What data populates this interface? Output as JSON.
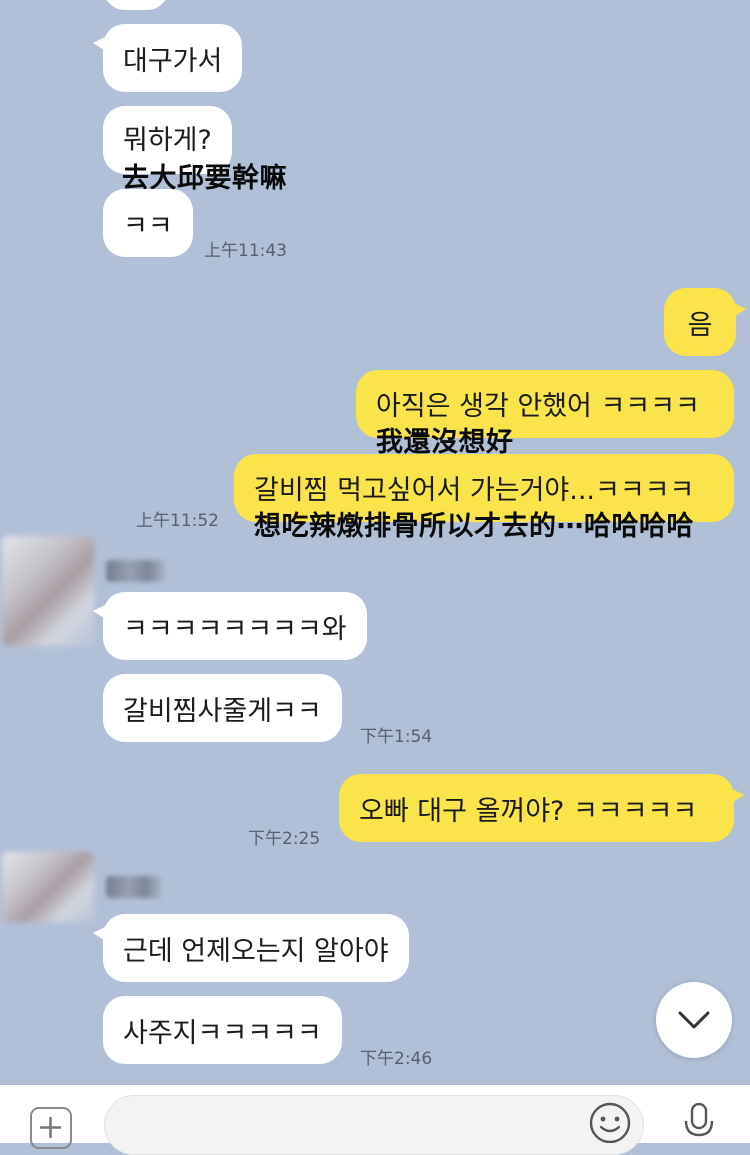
{
  "messages": {
    "m1": "대구가서",
    "m2": "뭐하게?",
    "m3": "ㅋㅋ",
    "m4": "음",
    "m5": "아직은 생각 안했어 ㅋㅋㅋㅋ",
    "m6": "갈비찜 먹고싶어서 가는거야...ㅋㅋㅋㅋ",
    "m7": "ㅋㅋㅋㅋㅋㅋㅋㅋ와",
    "m8": "갈비찜사줄게ㅋㅋ",
    "m9": "오빠 대구 올꺼야? ㅋㅋㅋㅋㅋ",
    "m10": "근데 언제오는지 알아야",
    "m11": "사주지ㅋㅋㅋㅋㅋ"
  },
  "captions": {
    "c1": "去大邱要幹嘛",
    "c2": "我還沒想好",
    "c3": "想吃辣燉排骨所以才去的⋯哈哈哈哈"
  },
  "times": {
    "t1": "上午11:43",
    "t2": "上午11:52",
    "t3": "下午1:54",
    "t4": "下午2:25",
    "t5": "下午2:46"
  },
  "colors": {
    "chat_background": "#b2c0d7",
    "outgoing_bubble": "#fbe44b",
    "incoming_bubble": "#ffffff"
  },
  "icons": {
    "scroll_down": "chevron-down-icon",
    "attach": "plus-icon",
    "emoji": "smiley-icon",
    "voice": "microphone-icon"
  }
}
